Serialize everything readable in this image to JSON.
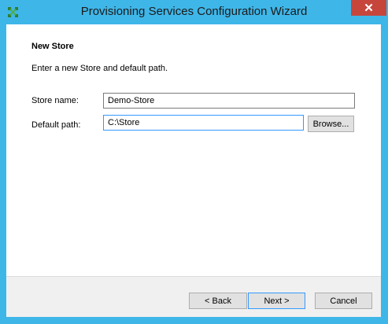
{
  "window": {
    "title": "Provisioning Services Configuration Wizard",
    "close_glyph": "✕",
    "accent_color": "#3fb6e8",
    "close_color": "#c7463c",
    "app_icon": "citrix-x-icon"
  },
  "page": {
    "heading": "New Store",
    "description": "Enter a new Store and default path."
  },
  "form": {
    "store_name_label": "Store name:",
    "store_name_value": "Demo-Store",
    "default_path_label": "Default path:",
    "default_path_value": "C:\\Store",
    "browse_label": "Browse..."
  },
  "footer": {
    "back_label": "< Back",
    "next_label": "Next >",
    "cancel_label": "Cancel"
  }
}
